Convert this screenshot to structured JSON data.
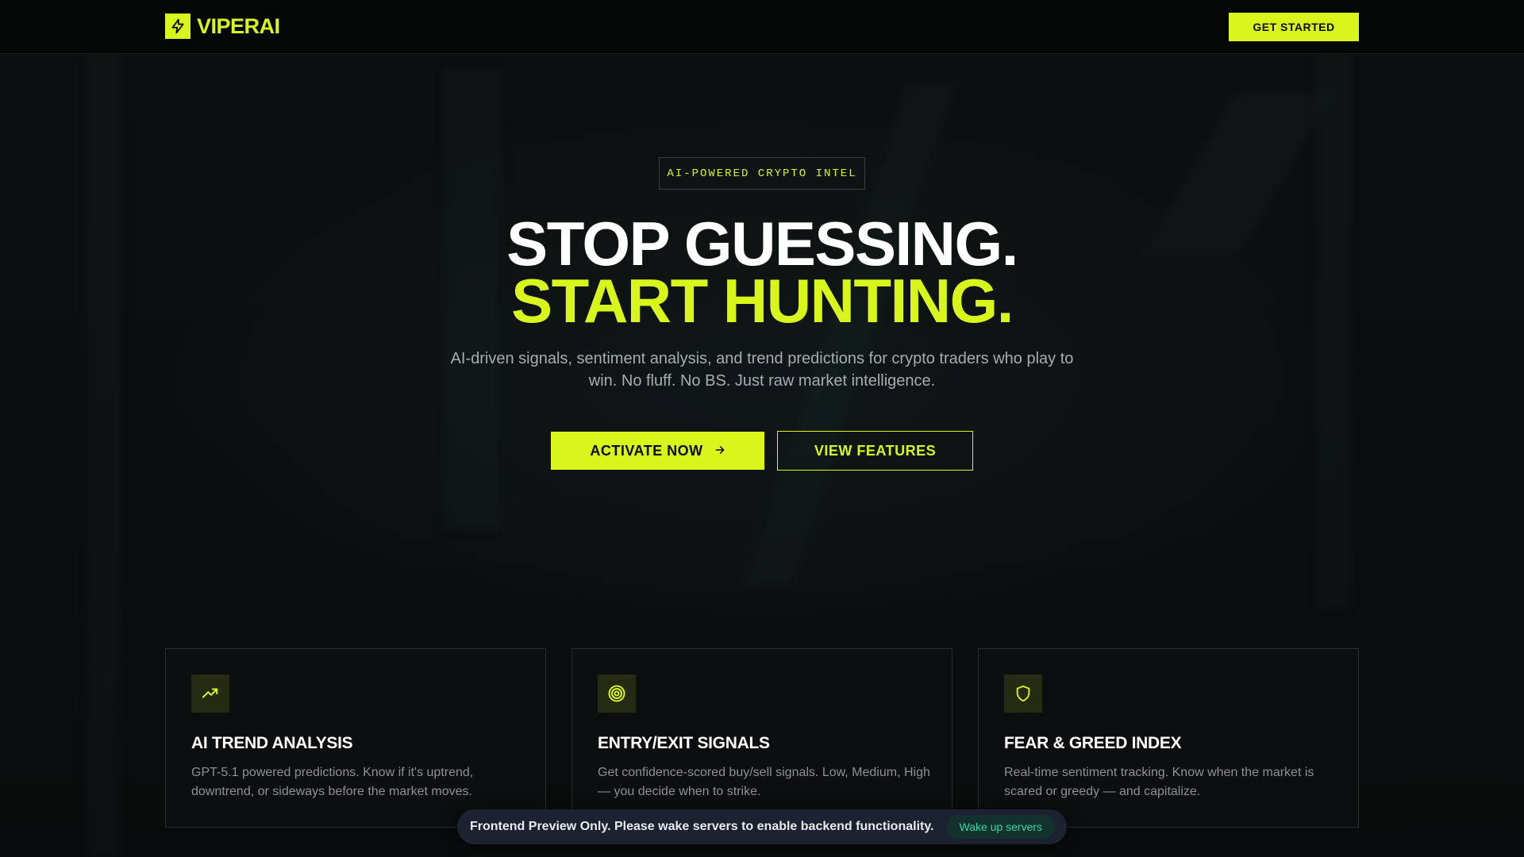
{
  "header": {
    "logo_text": "VIPERAI",
    "cta_label": "GET STARTED"
  },
  "hero": {
    "badge": "AI-POWERED CRYPTO INTEL",
    "headline_line1": "STOP GUESSING.",
    "headline_line2": "START HUNTING.",
    "subtitle": "AI-driven signals, sentiment analysis, and trend predictions for crypto traders who play to win. No fluff. No BS. Just raw market intelligence.",
    "primary_cta": "ACTIVATE NOW",
    "secondary_cta": "VIEW FEATURES"
  },
  "features": [
    {
      "icon": "trending-up-icon",
      "title": "AI TREND ANALYSIS",
      "description": "GPT-5.1 powered predictions. Know if it's uptrend, downtrend, or sideways before the market moves."
    },
    {
      "icon": "target-icon",
      "title": "ENTRY/EXIT SIGNALS",
      "description": "Get confidence-scored buy/sell signals. Low, Medium, High — you decide when to strike."
    },
    {
      "icon": "shield-icon",
      "title": "FEAR & GREED INDEX",
      "description": "Real-time sentiment tracking. Know when the market is scared or greedy — and capitalize."
    }
  ],
  "toast": {
    "message": "Frontend Preview Only. Please wake servers to enable backend functionality.",
    "button_label": "Wake up servers"
  },
  "colors": {
    "accent": "#d8f51c",
    "background": "#0b0d0e",
    "toast_button_text": "#35d9a4"
  }
}
